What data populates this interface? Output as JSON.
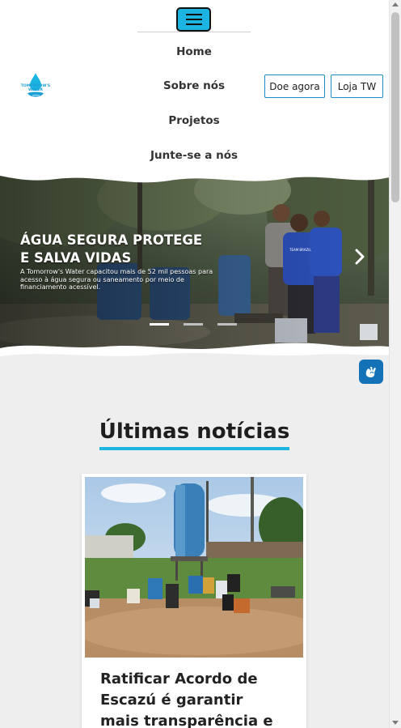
{
  "header": {
    "logo_text": "TOMORROW'S WATER",
    "nav": [
      "Home",
      "Sobre nós",
      "Projetos",
      "Junte-se a nós"
    ],
    "donate_label": "Doe agora",
    "store_label": "Loja TW"
  },
  "hero": {
    "title": "ÁGUA SEGURA PROTEGE E SALVA VIDAS",
    "subtitle": "A Tomorrow's Water capacitou mais de 52 mil pessoas para acesso à água segura ou saneamento por meio de financiamento acessível.",
    "shirt_text": "TEAM BRAZIL",
    "slide_count": 3,
    "active_slide": 1
  },
  "news": {
    "heading": "Últimas notícias",
    "articles": [
      {
        "title": "Ratificar Acordo de Escazú é garantir mais transparência e"
      }
    ]
  },
  "colors": {
    "accent": "#1cb4e0",
    "button_border": "#1a8fc5",
    "accessibility": "#1472b8"
  }
}
